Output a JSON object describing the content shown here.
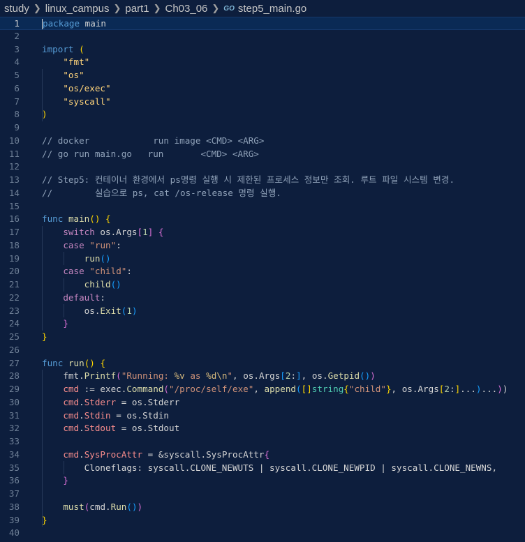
{
  "breadcrumb": {
    "items": [
      "study",
      "linux_campus",
      "part1",
      "Ch03_06"
    ],
    "file_icon": "GO",
    "file": "step5_main.go"
  },
  "editor": {
    "active_line": 1,
    "lines": [
      [
        [
          "kw",
          "package"
        ],
        [
          "plain",
          " main"
        ]
      ],
      [],
      [
        [
          "kw",
          "import"
        ],
        [
          "plain",
          " "
        ],
        [
          "p1",
          "("
        ]
      ],
      [
        [
          "plain",
          "    "
        ],
        [
          "str2",
          "\"fmt\""
        ]
      ],
      [
        [
          "plain",
          "    "
        ],
        [
          "str2",
          "\"os\""
        ]
      ],
      [
        [
          "plain",
          "    "
        ],
        [
          "str2",
          "\"os/exec\""
        ]
      ],
      [
        [
          "plain",
          "    "
        ],
        [
          "str2",
          "\"syscall\""
        ]
      ],
      [
        [
          "p1",
          ")"
        ]
      ],
      [],
      [
        [
          "cmt",
          "// docker            run image <CMD> <ARG>"
        ]
      ],
      [
        [
          "cmt",
          "// go run main.go   run       <CMD> <ARG>"
        ]
      ],
      [],
      [
        [
          "cmt",
          "// Step5: 컨테이너 환경에서 ps명령 실행 시 제한된 프로세스 정보만 조회. 루트 파일 시스템 변경."
        ]
      ],
      [
        [
          "cmt",
          "//        실습으로 ps, cat /os-release 명령 실행."
        ]
      ],
      [],
      [
        [
          "kw",
          "func"
        ],
        [
          "plain",
          " "
        ],
        [
          "fn",
          "main"
        ],
        [
          "p1",
          "()"
        ],
        [
          "plain",
          " "
        ],
        [
          "p1",
          "{"
        ]
      ],
      [
        [
          "plain",
          "    "
        ],
        [
          "ctrl",
          "switch"
        ],
        [
          "plain",
          " os.Args"
        ],
        [
          "p2",
          "["
        ],
        [
          "num",
          "1"
        ],
        [
          "p2",
          "]"
        ],
        [
          "plain",
          " "
        ],
        [
          "p2",
          "{"
        ]
      ],
      [
        [
          "plain",
          "    "
        ],
        [
          "ctrl",
          "case"
        ],
        [
          "plain",
          " "
        ],
        [
          "str",
          "\"run\""
        ],
        [
          "plain",
          ":"
        ]
      ],
      [
        [
          "plain",
          "        "
        ],
        [
          "fn",
          "run"
        ],
        [
          "p3",
          "()"
        ]
      ],
      [
        [
          "plain",
          "    "
        ],
        [
          "ctrl",
          "case"
        ],
        [
          "plain",
          " "
        ],
        [
          "str",
          "\"child\""
        ],
        [
          "plain",
          ":"
        ]
      ],
      [
        [
          "plain",
          "        "
        ],
        [
          "fn",
          "child"
        ],
        [
          "p3",
          "()"
        ]
      ],
      [
        [
          "plain",
          "    "
        ],
        [
          "ctrl",
          "default"
        ],
        [
          "plain",
          ":"
        ]
      ],
      [
        [
          "plain",
          "        os."
        ],
        [
          "fn",
          "Exit"
        ],
        [
          "p3",
          "("
        ],
        [
          "num",
          "1"
        ],
        [
          "p3",
          ")"
        ]
      ],
      [
        [
          "plain",
          "    "
        ],
        [
          "p2",
          "}"
        ]
      ],
      [
        [
          "p1",
          "}"
        ]
      ],
      [],
      [
        [
          "kw",
          "func"
        ],
        [
          "plain",
          " "
        ],
        [
          "fn",
          "run"
        ],
        [
          "p1",
          "()"
        ],
        [
          "plain",
          " "
        ],
        [
          "p1",
          "{"
        ]
      ],
      [
        [
          "plain",
          "    fmt."
        ],
        [
          "fn",
          "Printf"
        ],
        [
          "p2",
          "("
        ],
        [
          "str",
          "\"Running: "
        ],
        [
          "fmt",
          "%v"
        ],
        [
          "str",
          " as "
        ],
        [
          "fmt",
          "%d\\n"
        ],
        [
          "str",
          "\""
        ],
        [
          "plain",
          ", os.Args"
        ],
        [
          "p3",
          "["
        ],
        [
          "num",
          "2"
        ],
        [
          "plain",
          ":"
        ],
        [
          "p3",
          "]"
        ],
        [
          "plain",
          ", os."
        ],
        [
          "fn",
          "Getpid"
        ],
        [
          "p3",
          "()"
        ],
        [
          "p2",
          ")"
        ]
      ],
      [
        [
          "plain",
          "    "
        ],
        [
          "var",
          "cmd"
        ],
        [
          "plain",
          " := exec."
        ],
        [
          "fn",
          "Command"
        ],
        [
          "p2",
          "("
        ],
        [
          "str",
          "\"/proc/self/exe\""
        ],
        [
          "plain",
          ", "
        ],
        [
          "fn",
          "append"
        ],
        [
          "p3",
          "("
        ],
        [
          "p1",
          "[]"
        ],
        [
          "type",
          "string"
        ],
        [
          "p1",
          "{"
        ],
        [
          "str",
          "\"child\""
        ],
        [
          "p1",
          "}"
        ],
        [
          "plain",
          ", os.Args"
        ],
        [
          "p1",
          "["
        ],
        [
          "num",
          "2"
        ],
        [
          "plain",
          ":"
        ],
        [
          "p1",
          "]"
        ],
        [
          "plain",
          "..."
        ],
        [
          "p3",
          ")"
        ],
        [
          "plain",
          "..."
        ],
        [
          "p2",
          ")"
        ],
        [
          "plain",
          ")"
        ]
      ],
      [
        [
          "plain",
          "    "
        ],
        [
          "var",
          "cmd"
        ],
        [
          "plain",
          "."
        ],
        [
          "var",
          "Stderr"
        ],
        [
          "plain",
          " = os.Stderr"
        ]
      ],
      [
        [
          "plain",
          "    "
        ],
        [
          "var",
          "cmd"
        ],
        [
          "plain",
          "."
        ],
        [
          "var",
          "Stdin"
        ],
        [
          "plain",
          " = os.Stdin"
        ]
      ],
      [
        [
          "plain",
          "    "
        ],
        [
          "var",
          "cmd"
        ],
        [
          "plain",
          "."
        ],
        [
          "var",
          "Stdout"
        ],
        [
          "plain",
          " = os.Stdout"
        ]
      ],
      [],
      [
        [
          "plain",
          "    "
        ],
        [
          "var",
          "cmd"
        ],
        [
          "plain",
          "."
        ],
        [
          "var",
          "SysProcAttr"
        ],
        [
          "plain",
          " = &syscall.SysProcAttr"
        ],
        [
          "p2",
          "{"
        ]
      ],
      [
        [
          "plain",
          "        Cloneflags: syscall.CLONE_NEWUTS | syscall.CLONE_NEWPID | syscall.CLONE_NEWNS,"
        ]
      ],
      [
        [
          "plain",
          "    "
        ],
        [
          "p2",
          "}"
        ]
      ],
      [],
      [
        [
          "plain",
          "    "
        ],
        [
          "fn",
          "must"
        ],
        [
          "p2",
          "("
        ],
        [
          "plain",
          "cmd."
        ],
        [
          "fn",
          "Run"
        ],
        [
          "p3",
          "()"
        ],
        [
          "p2",
          ")"
        ]
      ],
      [
        [
          "p1",
          "}"
        ]
      ],
      []
    ]
  }
}
